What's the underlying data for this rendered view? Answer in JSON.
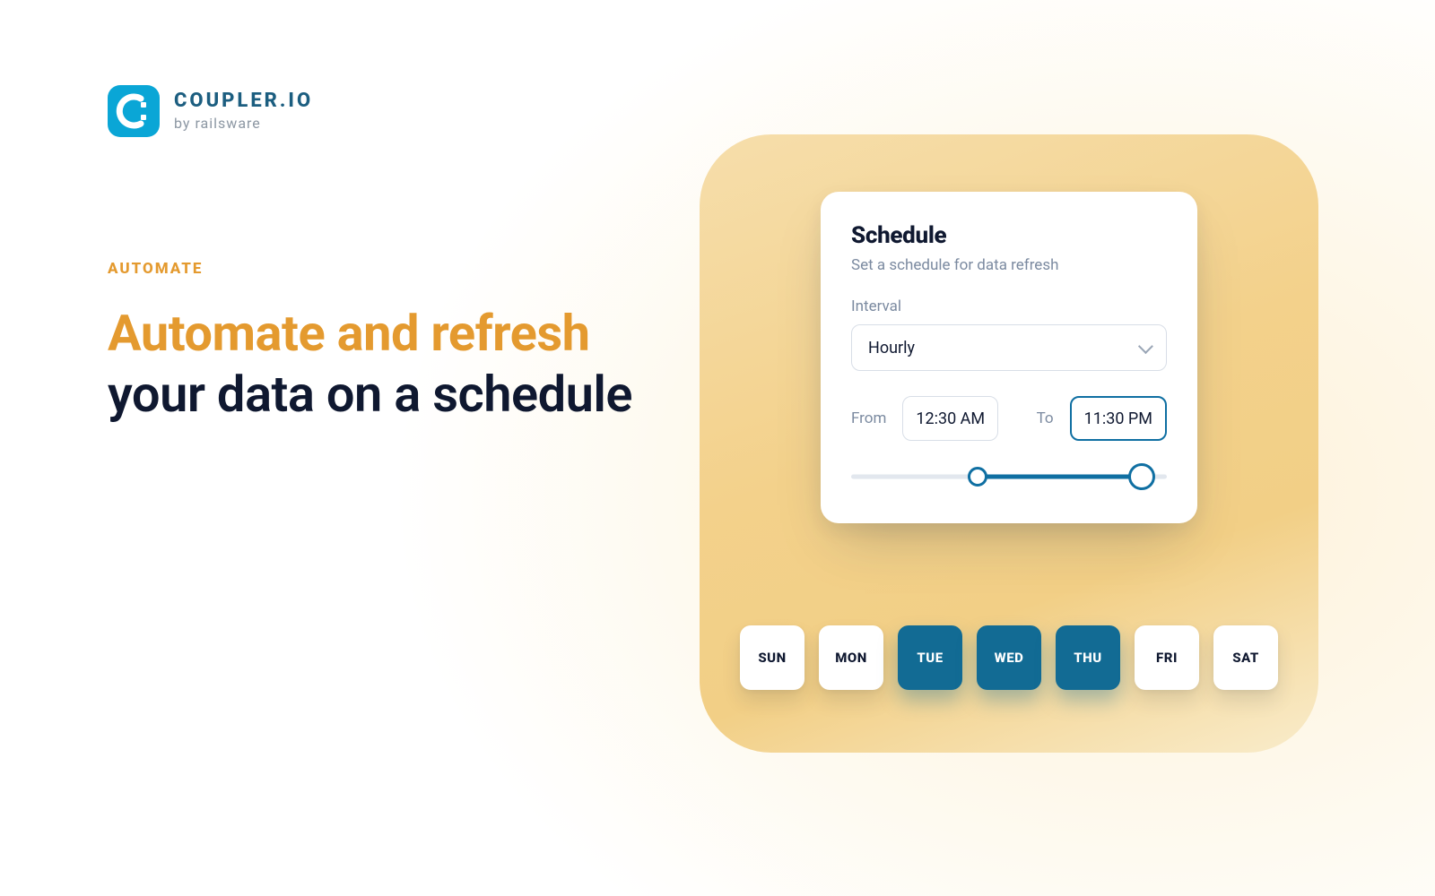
{
  "brand": {
    "name": "COUPLER.IO",
    "subtitle": "by railsware"
  },
  "copy": {
    "eyebrow": "AUTOMATE",
    "headline_accent": "Automate and refresh",
    "headline_rest": " your data on a schedule"
  },
  "card": {
    "title": "Schedule",
    "subtitle": "Set a schedule for data refresh",
    "interval_label": "Interval",
    "interval_value": "Hourly",
    "from_label": "From",
    "from_value": "12:30 AM",
    "to_label": "To",
    "to_value": "11:30 PM",
    "slider_start_pct": 40,
    "slider_end_pct": 92
  },
  "days": [
    {
      "abbr": "SUN",
      "selected": false
    },
    {
      "abbr": "MON",
      "selected": false
    },
    {
      "abbr": "TUE",
      "selected": true
    },
    {
      "abbr": "WED",
      "selected": true
    },
    {
      "abbr": "THU",
      "selected": true
    },
    {
      "abbr": "FRI",
      "selected": false
    },
    {
      "abbr": "SAT",
      "selected": false
    }
  ]
}
